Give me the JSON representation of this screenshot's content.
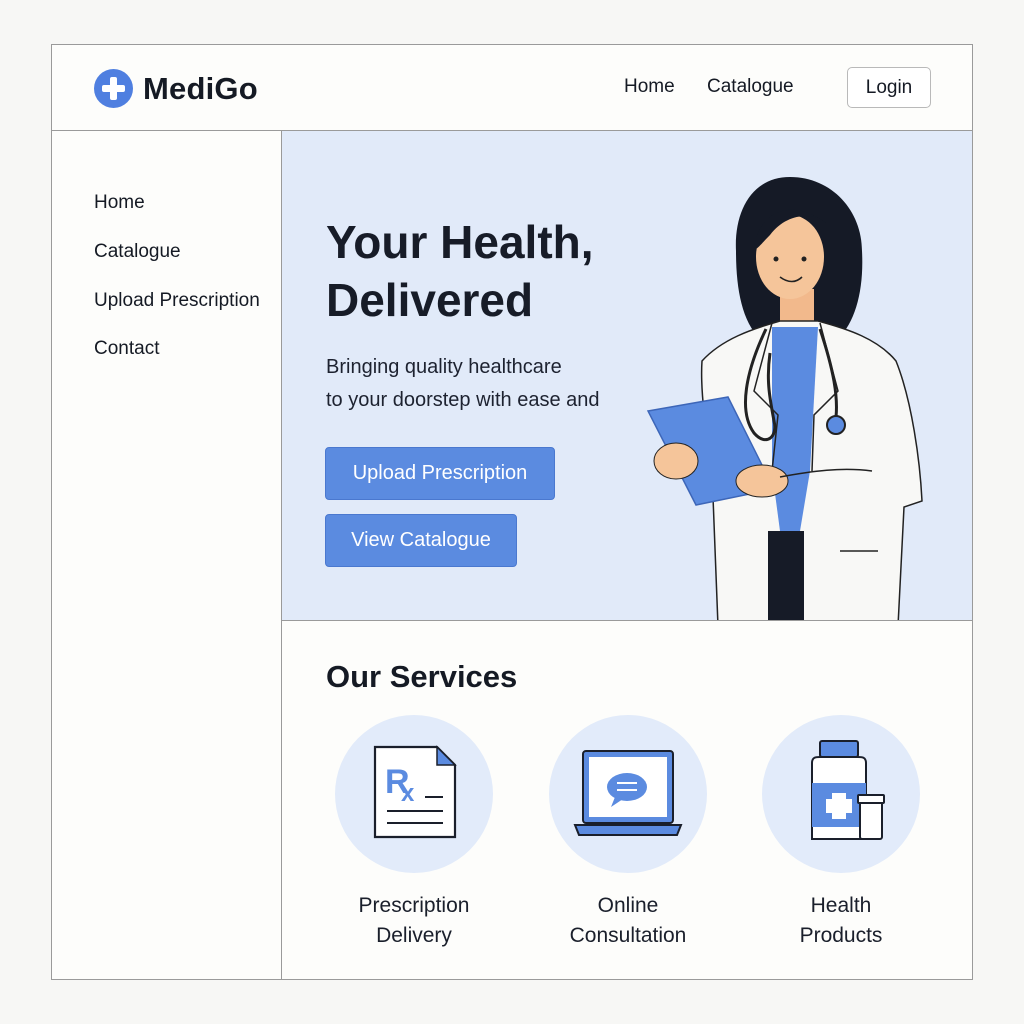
{
  "brand": {
    "name": "MediGo",
    "logo_icon": "plus-circle-icon",
    "accent": "#4f7fe0"
  },
  "header": {
    "nav": [
      "Home",
      "Catalogue"
    ],
    "login_label": "Login"
  },
  "sidebar": {
    "items": [
      {
        "label": "Home"
      },
      {
        "label": "Catalogue"
      },
      {
        "label": "Upload Prescription"
      },
      {
        "label": "Contact"
      }
    ]
  },
  "hero": {
    "title": "Your Health, Delivered",
    "subtitle": "Bringing quality healthcare\nto your doorstep with ease and",
    "primary_button": "Upload Prescription",
    "secondary_button": "View Catalogue",
    "background": "#e1eaf9",
    "button_color": "#5b8be0"
  },
  "services": {
    "title": "Our Services",
    "items": [
      {
        "label": "Prescription\nDelivery",
        "icon": "prescription-document-icon"
      },
      {
        "label": "Online\nConsultation",
        "icon": "laptop-chat-icon"
      },
      {
        "label": "Health\nProducts",
        "icon": "medicine-bottle-icon"
      }
    ]
  }
}
